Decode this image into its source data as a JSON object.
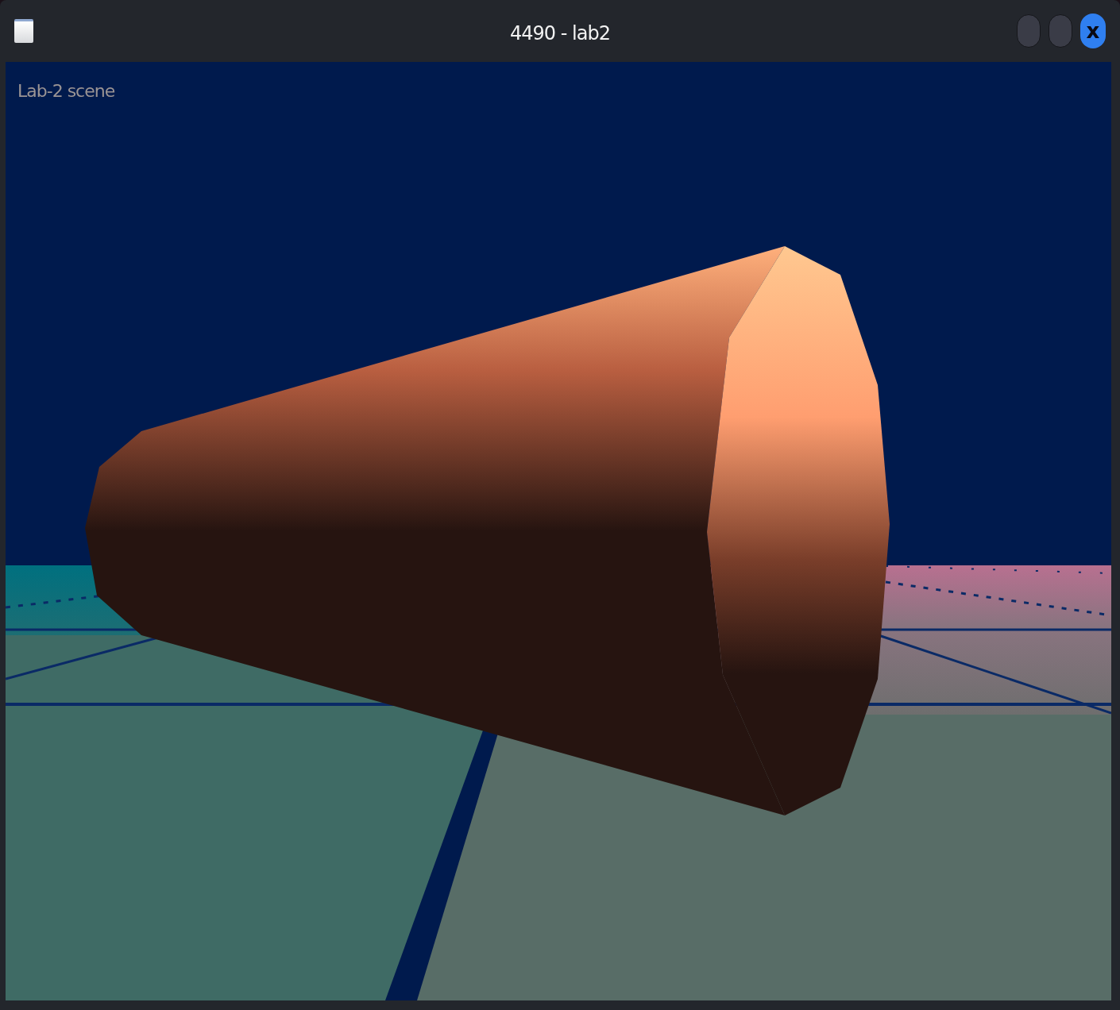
{
  "window": {
    "title": "4490 - lab2",
    "close_button": "x"
  },
  "viewport": {
    "label": "Lab-2 scene"
  }
}
